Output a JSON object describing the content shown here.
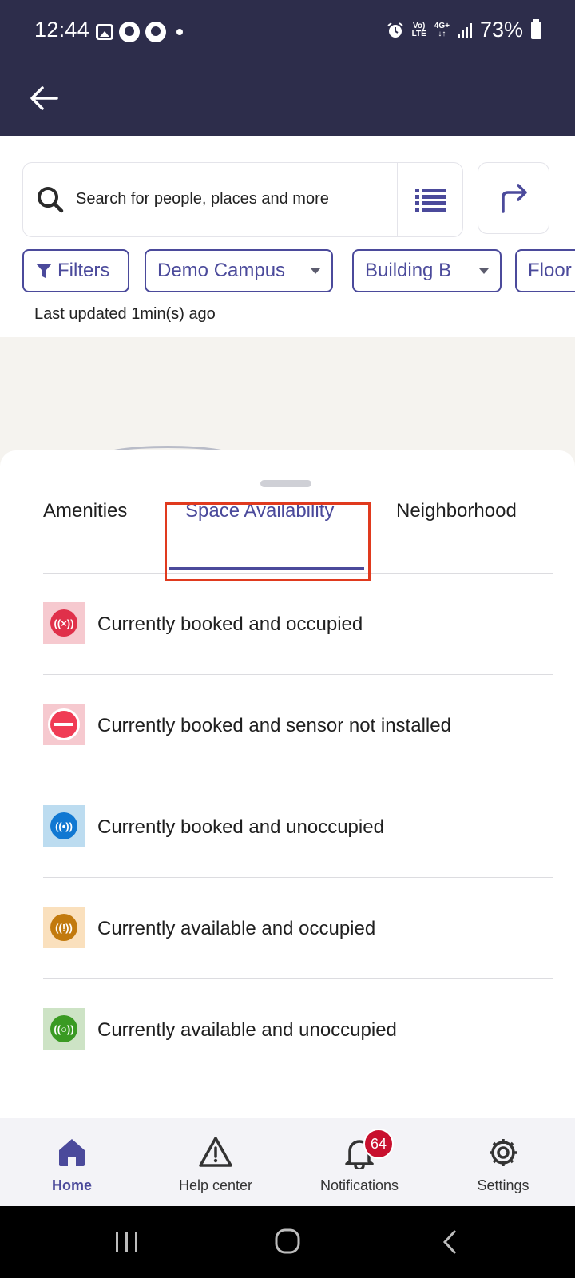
{
  "status_bar": {
    "time": "12:44",
    "network_top": "Vo)",
    "network_bottom": "LTE",
    "data_top": "4G+",
    "data_bottom": "↓↑",
    "battery": "73%"
  },
  "search": {
    "placeholder": "Search for people, places and more"
  },
  "filters": {
    "filters_label": "Filters",
    "campus": "Demo Campus",
    "building": "Building B",
    "floor": "Floor"
  },
  "last_updated": "Last updated 1min(s) ago",
  "tabs": {
    "items": [
      {
        "label": "Amenities"
      },
      {
        "label": "Space Availability"
      },
      {
        "label": "Neighborhood"
      }
    ],
    "active_index": 1
  },
  "legend": [
    {
      "label": "Currently booked and occupied",
      "icon": "booked-occupied-icon",
      "swatch_bg": "#f6c9cf",
      "dot_color": "#e0304a",
      "glyph": "((×))"
    },
    {
      "label": "Currently booked and sensor not installed",
      "icon": "no-sensor-icon",
      "swatch_bg": "#f6c9cf",
      "dot_color": "#f03c55",
      "glyph": ""
    },
    {
      "label": "Currently booked and unoccupied",
      "icon": "booked-unoccupied-icon",
      "swatch_bg": "#bcdcf0",
      "dot_color": "#1178d2",
      "glyph": "((•))"
    },
    {
      "label": "Currently available and occupied",
      "icon": "available-occupied-icon",
      "swatch_bg": "#fae0bd",
      "dot_color": "#c27a0e",
      "glyph": "((!))"
    },
    {
      "label": "Currently available and unoccupied",
      "icon": "available-unoccupied-icon",
      "swatch_bg": "#cde3c5",
      "dot_color": "#3a9a23",
      "glyph": "((○))"
    }
  ],
  "bottom_nav": {
    "items": [
      {
        "label": "Home",
        "icon": "home-icon"
      },
      {
        "label": "Help center",
        "icon": "warning-icon"
      },
      {
        "label": "Notifications",
        "icon": "bell-icon",
        "badge": "64"
      },
      {
        "label": "Settings",
        "icon": "gear-icon"
      }
    ],
    "active_index": 0
  },
  "colors": {
    "header_bg": "#2d2d4b",
    "accent": "#4b4a9b",
    "highlight": "#e03a1e",
    "badge": "#c8102e"
  }
}
